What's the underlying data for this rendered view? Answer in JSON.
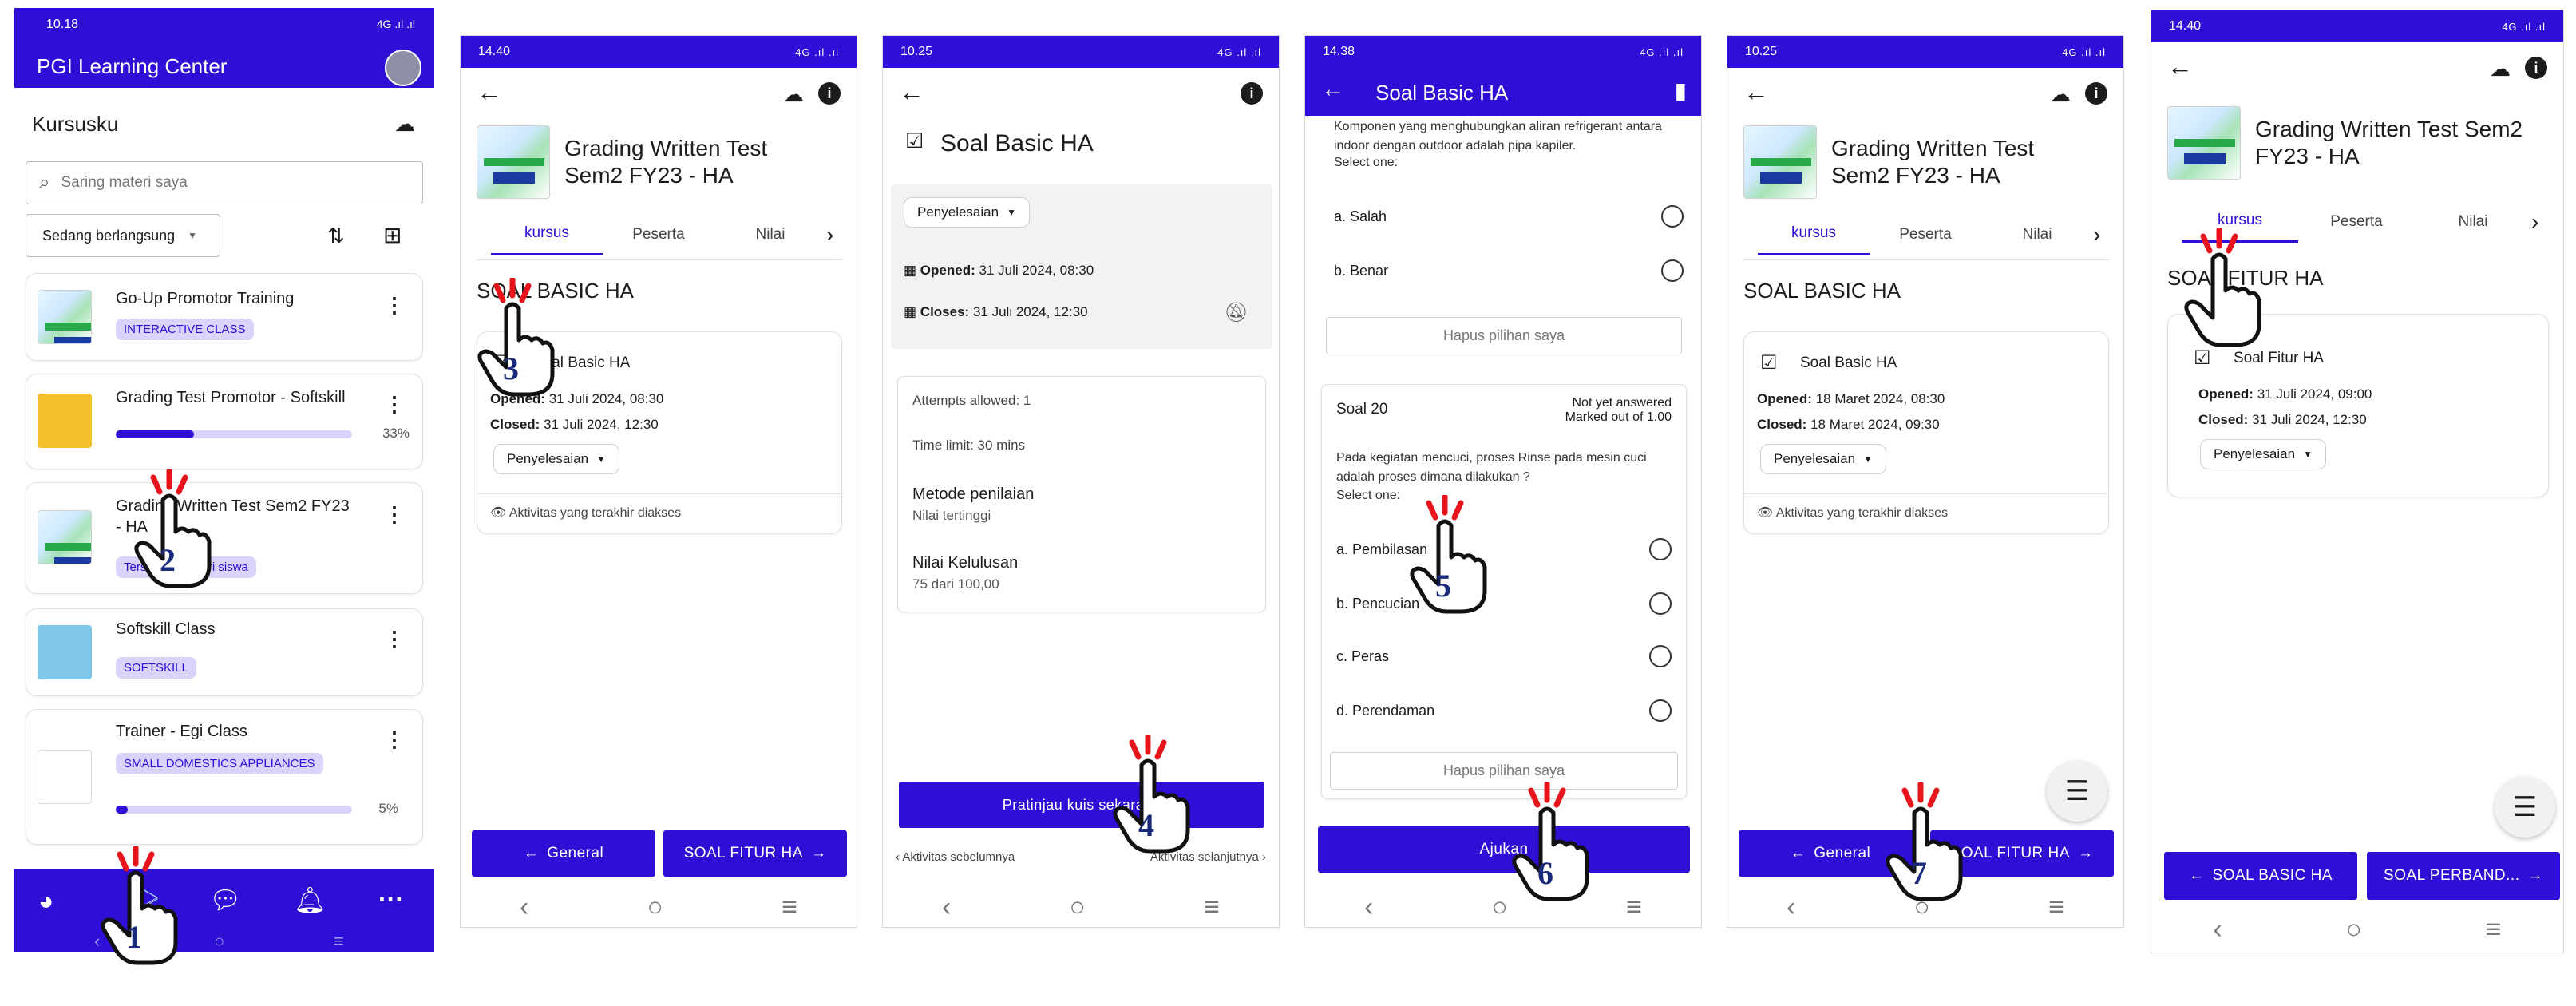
{
  "screen1": {
    "status_time": "10.18",
    "status_right": "4G .ıl .ıl",
    "app_title": "PGI Learning Center",
    "section_title": "Kursusku",
    "search_placeholder": "Saring materi saya",
    "filter_label": "Sedang berlangsung",
    "courses": [
      {
        "title": "Go-Up Promotor Training",
        "chip": "INTERACTIVE CLASS",
        "progress": null,
        "progress_text": ""
      },
      {
        "title": "Grading Test Promotor - Softskill",
        "chip": "",
        "progress": 0.33,
        "progress_text": "33%"
      },
      {
        "title": "Grading Written Test Sem2 FY23 - HA",
        "chip": "Tersembunyi dari siswa",
        "progress": null,
        "progress_text": ""
      },
      {
        "title": "Softskill Class",
        "chip": "SOFTSKILL",
        "progress": null,
        "progress_text": ""
      },
      {
        "title": "Trainer - Egi Class",
        "chip": "SMALL DOMESTICS APPLIANCES",
        "progress": 0.05,
        "progress_text": "5%"
      }
    ]
  },
  "screen2": {
    "status_time": "14.40",
    "status_right": "4G .ıl .ıl",
    "course_title": "Grading Written Test Sem2 FY23 - HA",
    "tabs": [
      "kursus",
      "Peserta",
      "Nilai"
    ],
    "section_title": "SOAL BASIC HA",
    "activity_title": "Soal Basic HA",
    "opened_label": "Opened:",
    "opened_value": "31 Juli 2024, 08:30",
    "closed_label": "Closed:",
    "closed_value": "31 Juli 2024, 12:30",
    "completion_label": "Penyelesaian",
    "recent_label": "Aktivitas yang terakhir diakses",
    "btn_prev": "General",
    "btn_next": "SOAL FITUR HA"
  },
  "screen3": {
    "status_time": "10.25",
    "status_right": "4G .ıl .ıl",
    "title": "Soal Basic HA",
    "completion_label": "Penyelesaian",
    "opened_label": "Opened:",
    "opened_value": "31 Juli 2024, 08:30",
    "closes_label": "Closes:",
    "closes_value": "31 Juli 2024, 12:30",
    "attempts": "Attempts allowed: 1",
    "time_limit": "Time limit: 30 mins",
    "grading_method_label": "Metode penilaian",
    "grading_method_value": "Nilai tertinggi",
    "pass_label": "Nilai Kelulusan",
    "pass_value": "75 dari 100,00",
    "preview_btn": "Pratinjau kuis sekarang",
    "prev_activity": "Aktivitas sebelumnya",
    "next_activity": "Aktivitas selanjutnya"
  },
  "screen4": {
    "status_time": "14.38",
    "status_right": "4G .ıl .ıl",
    "title": "Soal Basic HA",
    "question_text_top": "Komponen yang menghubungkan aliran refrigerant antara indoor dengan outdoor adalah pipa kapiler.",
    "select_one": "Select one:",
    "options_top": [
      {
        "key": "a.",
        "label": "Salah"
      },
      {
        "key": "b.",
        "label": "Benar"
      }
    ],
    "clear_label": "Hapus pilihan saya",
    "q20_number": "Soal 20",
    "q20_status": "Not yet answered",
    "q20_marks": "Marked out of 1.00",
    "q20_text": "Pada kegiatan mencuci, proses Rinse pada mesin cuci adalah proses dimana dilakukan ?",
    "q20_select_one": "Select one:",
    "options_q20": [
      {
        "key": "a.",
        "label": "Pembilasan"
      },
      {
        "key": "b.",
        "label": "Pencucian"
      },
      {
        "key": "c.",
        "label": "Peras"
      },
      {
        "key": "d.",
        "label": "Perendaman"
      }
    ],
    "submit_btn": "Ajukan"
  },
  "screen5": {
    "status_time": "10.25",
    "status_right": "4G .ıl .ıl",
    "course_title": "Grading Written Test Sem2 FY23 - HA",
    "tabs": [
      "kursus",
      "Peserta",
      "Nilai"
    ],
    "section_title": "SOAL BASIC HA",
    "activity_title": "Soal Basic HA",
    "opened_label": "Opened:",
    "opened_value": "18 Maret 2024, 08:30",
    "closed_label": "Closed:",
    "closed_value": "18 Maret 2024, 09:30",
    "completion_label": "Penyelesaian",
    "recent_label": "Aktivitas yang terakhir diakses",
    "btn_prev": "General",
    "btn_next": "SOAL FITUR HA"
  },
  "screen6": {
    "status_time": "14.40",
    "status_right": "4G .ıl .ıl",
    "course_title": "Grading Written Test Sem2 FY23 - HA",
    "tabs": [
      "kursus",
      "Peserta",
      "Nilai"
    ],
    "section_title": "SOAL FITUR HA",
    "activity_title": "Soal Fitur HA",
    "opened_label": "Opened:",
    "opened_value": "31 Juli 2024, 09:00",
    "closed_label": "Closed:",
    "closed_value": "31 Juli 2024, 12:30",
    "completion_label": "Penyelesaian",
    "btn_prev": "SOAL BASIC HA",
    "btn_next": "SOAL PERBAND..."
  },
  "steps": [
    "1",
    "2",
    "3",
    "4",
    "5",
    "6",
    "7"
  ],
  "colors": {
    "primary": "#2d0fd6",
    "chip_bg": "#d8d4fb",
    "step_number": "#1a2a7a",
    "tap_rays": "#e8141c"
  }
}
